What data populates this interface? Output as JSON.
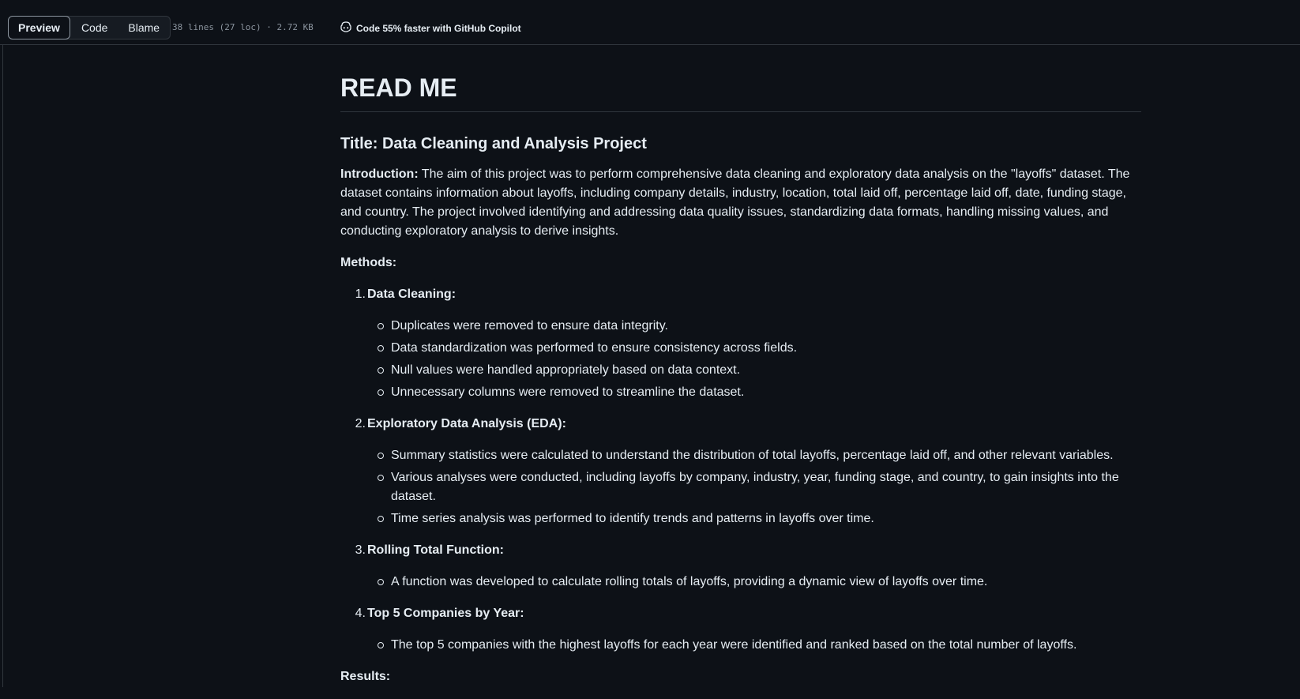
{
  "toolbar": {
    "tabs": [
      {
        "label": "Preview",
        "active": true
      },
      {
        "label": "Code",
        "active": false
      },
      {
        "label": "Blame",
        "active": false
      }
    ],
    "file_meta": "38 lines (27 loc) · 2.72 KB",
    "copilot_label": "Code 55% faster with GitHub Copilot"
  },
  "readme": {
    "heading": "READ ME",
    "title": "Title: Data Cleaning and Analysis Project",
    "intro_label": "Introduction:",
    "intro_text": " The aim of this project was to perform comprehensive data cleaning and exploratory data analysis on the \"layoffs\" dataset. The dataset contains information about layoffs, including company details, industry, location, total laid off, percentage laid off, date, funding stage, and country. The project involved identifying and addressing data quality issues, standardizing data formats, handling missing values, and conducting exploratory analysis to derive insights.",
    "methods_label": "Methods:",
    "methods": [
      {
        "num": "1.",
        "label": "Data Cleaning:",
        "items": [
          "Duplicates were removed to ensure data integrity.",
          "Data standardization was performed to ensure consistency across fields.",
          "Null values were handled appropriately based on data context.",
          "Unnecessary columns were removed to streamline the dataset."
        ]
      },
      {
        "num": "2.",
        "label": "Exploratory Data Analysis (EDA):",
        "items": [
          "Summary statistics were calculated to understand the distribution of total layoffs, percentage laid off, and other relevant variables.",
          "Various analyses were conducted, including layoffs by company, industry, year, funding stage, and country, to gain insights into the dataset.",
          "Time series analysis was performed to identify trends and patterns in layoffs over time."
        ]
      },
      {
        "num": "3.",
        "label": "Rolling Total Function:",
        "items": [
          "A function was developed to calculate rolling totals of layoffs, providing a dynamic view of layoffs over time."
        ]
      },
      {
        "num": "4.",
        "label": "Top 5 Companies by Year:",
        "items": [
          "The top 5 companies with the highest layoffs for each year were identified and ranked based on the total number of layoffs."
        ]
      }
    ],
    "results_label": "Results:"
  }
}
